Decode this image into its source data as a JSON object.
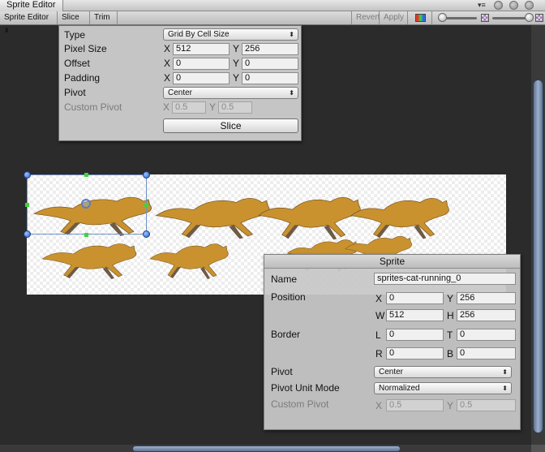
{
  "window": {
    "title": "Sprite Editor"
  },
  "toolbar": {
    "mode_label": "Sprite Editor",
    "slice_label": "Slice",
    "trim_label": "Trim",
    "revert_label": "Revert",
    "apply_label": "Apply",
    "dropdown_arrow": "⬍",
    "menu_glyph": "▾≡"
  },
  "slice_panel": {
    "type_label": "Type",
    "type_value": "Grid By Cell Size",
    "pixel_size_label": "Pixel Size",
    "pixel_size": {
      "x_label": "X",
      "x": "512",
      "y_label": "Y",
      "y": "256"
    },
    "offset_label": "Offset",
    "offset": {
      "x_label": "X",
      "x": "0",
      "y_label": "Y",
      "y": "0"
    },
    "padding_label": "Padding",
    "padding": {
      "x_label": "X",
      "x": "0",
      "y_label": "Y",
      "y": "0"
    },
    "pivot_label": "Pivot",
    "pivot_value": "Center",
    "custom_pivot_label": "Custom Pivot",
    "custom_pivot": {
      "x_label": "X",
      "x": "0.5",
      "y_label": "Y",
      "y": "0.5"
    },
    "slice_button": "Slice"
  },
  "sprite_panel": {
    "header": "Sprite",
    "name_label": "Name",
    "name_value": "sprites-cat-running_0",
    "position_label": "Position",
    "position": {
      "x_label": "X",
      "x": "0",
      "y_label": "Y",
      "y": "256",
      "w_label": "W",
      "w": "512",
      "h_label": "H",
      "h": "256"
    },
    "border_label": "Border",
    "border": {
      "l_label": "L",
      "l": "0",
      "t_label": "T",
      "t": "0",
      "r_label": "R",
      "r": "0",
      "b_label": "B",
      "b": "0"
    },
    "pivot_label": "Pivot",
    "pivot_value": "Center",
    "pivot_unit_label": "Pivot Unit Mode",
    "pivot_unit_value": "Normalized",
    "custom_pivot_label": "Custom Pivot",
    "custom_pivot": {
      "x_label": "X",
      "x": "0.5",
      "y_label": "Y",
      "y": "0.5"
    }
  },
  "colors": {
    "editor_bg": "#2b2b2b",
    "panel_bg": "#c5c5c5",
    "selection": "#6f8fc4",
    "cat_fill": "#c9922f",
    "cat_shadow": "#6f5a44"
  },
  "icons": [
    "menu-icon",
    "window-button-icon",
    "rgb-channel-icon",
    "zoom-slider-icon",
    "mip-level-icon",
    "dropdown-arrow-icon"
  ]
}
